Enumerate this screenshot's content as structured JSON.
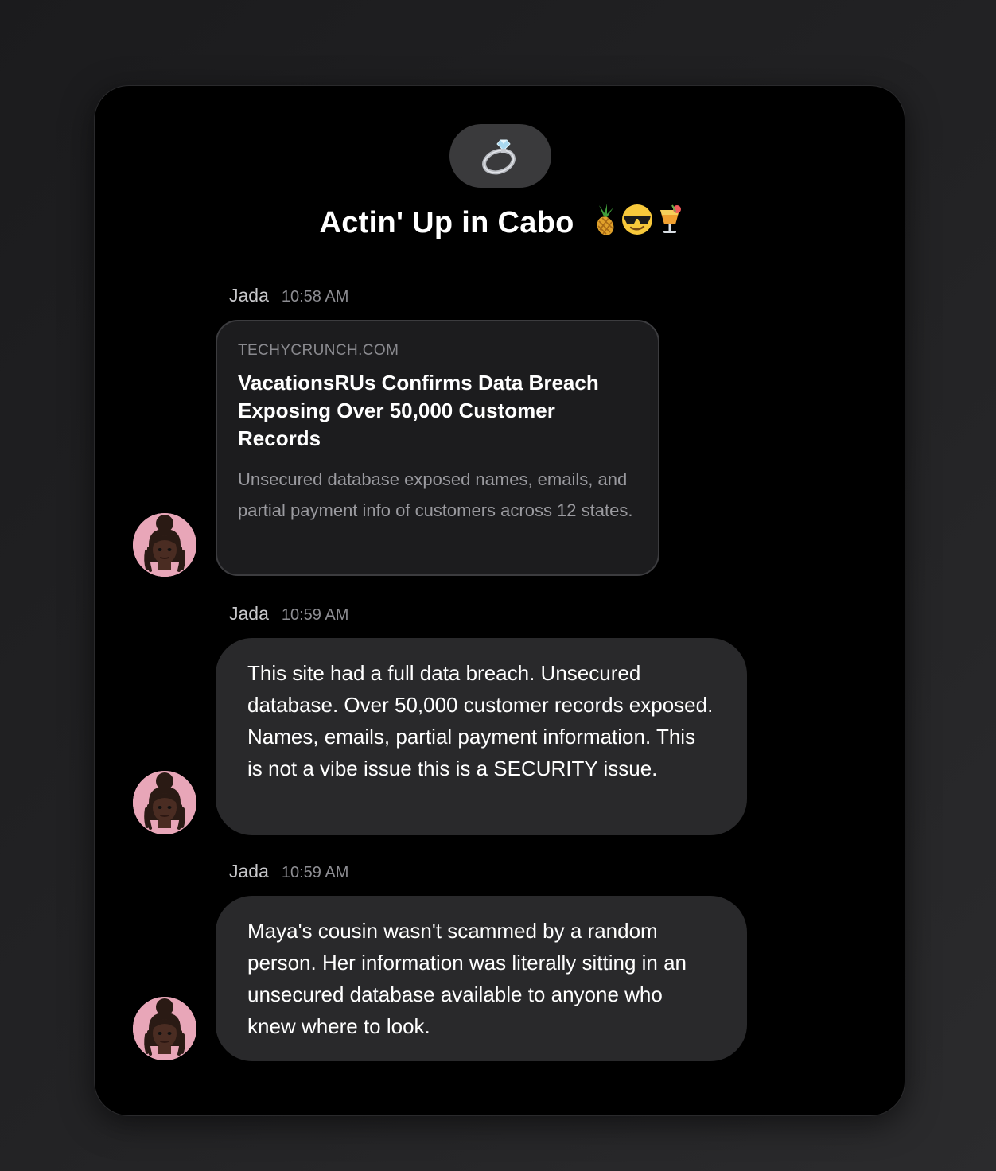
{
  "chat": {
    "group_icon": "ring-icon",
    "title": "Actin' Up in Cabo",
    "title_emojis": [
      "pineapple-icon",
      "sunglasses-face-icon",
      "tropical-drink-icon"
    ]
  },
  "messages": [
    {
      "sender": "Jada",
      "time": "10:58 AM",
      "type": "link",
      "link": {
        "domain": "TECHYCRUNCH.COM",
        "title": "VacationsRUs Confirms Data Breach Exposing Over 50,000 Customer Records",
        "description": "Unsecured database exposed names, emails, and partial payment info of customers across 12 states."
      }
    },
    {
      "sender": "Jada",
      "time": "10:59 AM",
      "type": "text",
      "text": "This site had a full data breach. Unsecured database. Over 50,000 customer records exposed. Names, emails, partial payment information. This is not a vibe issue this is a SECURITY issue."
    },
    {
      "sender": "Jada",
      "time": "10:59 AM",
      "type": "text",
      "text": "Maya's cousin wasn't scammed by a random person. Her information was literally sitting in an unsecured database available to anyone who knew where to look."
    }
  ],
  "colors": {
    "background": "#000000",
    "bubble": "#29292b",
    "link_card": "#1c1c1e",
    "avatar_bg": "#e8a6b8"
  }
}
